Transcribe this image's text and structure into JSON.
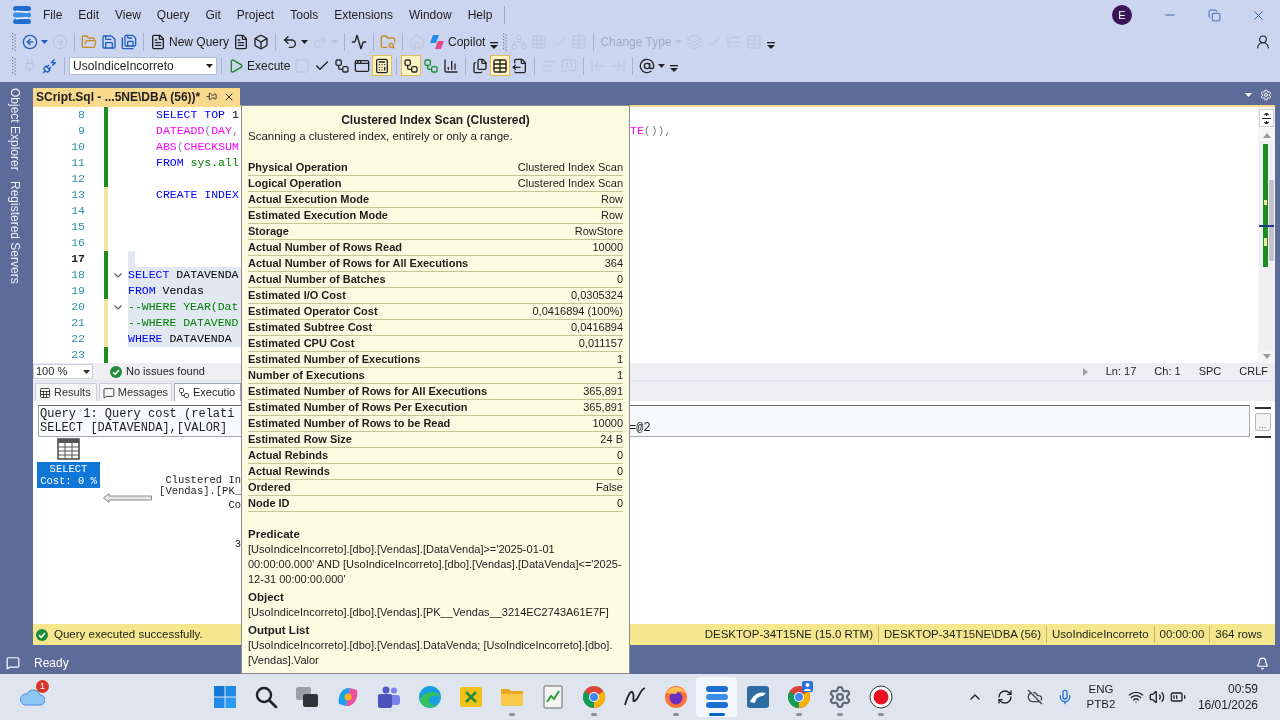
{
  "title_bar": {
    "menu": [
      "File",
      "Edit",
      "View",
      "Query",
      "Git",
      "Project",
      "Tools",
      "Extensions",
      "Window",
      "Help"
    ],
    "avatar": "E"
  },
  "toolbar_standard": {
    "items": [
      {
        "disabled": false
      },
      {
        "disabled": true
      },
      {
        "disabled": false
      },
      {
        "disabled": false
      },
      {
        "disabled": false
      },
      {
        "label": "New Query",
        "disabled": false
      },
      {
        "disabled": false
      },
      {
        "disabled": false
      },
      {
        "disabled": false
      },
      {
        "disabled": true
      },
      {
        "disabled": false
      },
      {
        "disabled": false
      },
      {
        "disabled": true
      },
      {
        "label": "Copilot",
        "disabled": false
      },
      {
        "disabled": true
      },
      {
        "disabled": true
      },
      {
        "disabled": true
      },
      {
        "disabled": true
      },
      {
        "label": "Change Type",
        "disabled": true
      },
      {
        "disabled": true
      },
      {
        "disabled": true
      },
      {
        "disabled": true
      },
      {
        "disabled": true
      }
    ]
  },
  "toolbar_sql": {
    "items": [
      {
        "disabled": true,
        "on": false
      },
      {
        "disabled": false,
        "on": false
      },
      {
        "label": "Execute",
        "disabled": false,
        "on": false
      },
      {
        "disabled": true,
        "on": false
      },
      {
        "disabled": false,
        "on": false
      },
      {
        "disabled": false,
        "on": false
      },
      {
        "disabled": false,
        "on": false
      },
      {
        "disabled": false,
        "on": true
      },
      {
        "disabled": false,
        "on": true
      },
      {
        "disabled": false,
        "on": false
      },
      {
        "disabled": false,
        "on": false
      },
      {
        "disabled": false,
        "on": false
      },
      {
        "disabled": false,
        "on": true
      },
      {
        "disabled": false,
        "on": false
      },
      {
        "disabled": true,
        "on": false
      },
      {
        "disabled": true,
        "on": false
      },
      {
        "disabled": true,
        "on": false
      },
      {
        "disabled": true,
        "on": false
      },
      {
        "disabled": false,
        "on": false
      }
    ],
    "database": "UsoIndiceIncorreto"
  },
  "side_panel": {
    "tabs": [
      "Object Explorer",
      "Registered Servers"
    ]
  },
  "document_tab": {
    "title": "SCript.Sql - ...5NE\\DBA (56))*",
    "selected": true
  },
  "editor": {
    "lines": [
      {
        "number": "8",
        "current": false,
        "selected": false,
        "fold": false,
        "indented": true,
        "color": "#1e8c1e",
        "tokens": [
          {
            "kind": "keyword",
            "text": "SELECT TOP"
          },
          {
            "kind": "plain",
            "text": " 1"
          }
        ]
      },
      {
        "number": "9",
        "current": false,
        "selected": false,
        "fold": false,
        "indented": true,
        "color": "#1e8c1e",
        "tokens": [
          {
            "kind": "function",
            "text": "DATEADD"
          },
          {
            "kind": "punct",
            "text": "("
          },
          {
            "kind": "function",
            "text": "DAY"
          },
          {
            "kind": "punct",
            "text": ","
          }
        ],
        "right_tokens": [
          {
            "kind": "function",
            "text": "TE"
          },
          {
            "kind": "punct",
            "text": "()),"
          }
        ]
      },
      {
        "number": "10",
        "current": false,
        "selected": false,
        "fold": false,
        "indented": true,
        "color": "#1e8c1e",
        "tokens": [
          {
            "kind": "function",
            "text": "ABS"
          },
          {
            "kind": "punct",
            "text": "("
          },
          {
            "kind": "function",
            "text": "CHECKSUM"
          }
        ]
      },
      {
        "number": "11",
        "current": false,
        "selected": false,
        "fold": false,
        "indented": true,
        "color": "#1e8c1e",
        "tokens": [
          {
            "kind": "keyword",
            "text": "FROM"
          },
          {
            "kind": "system",
            "text": " sys.all"
          }
        ]
      },
      {
        "number": "12",
        "current": false,
        "selected": false,
        "fold": false,
        "color": "#1e8c1e"
      },
      {
        "number": "13",
        "current": false,
        "selected": false,
        "fold": false,
        "indented": true,
        "color": "#f0e6a0",
        "tokens": [
          {
            "kind": "keyword",
            "text": "CREATE INDEX"
          }
        ]
      },
      {
        "number": "14",
        "current": false,
        "selected": false,
        "fold": false,
        "color": "#f0e6a0"
      },
      {
        "number": "15",
        "current": false,
        "selected": false,
        "fold": false,
        "color": "#f0e6a0"
      },
      {
        "number": "16",
        "current": false,
        "selected": false,
        "fold": false,
        "color": "#f0e6a0"
      },
      {
        "number": "17",
        "current": true,
        "selected": true,
        "fold": false,
        "color": "#1e8c1e"
      },
      {
        "number": "18",
        "current": false,
        "selected": true,
        "fold": true,
        "indented": false,
        "color": "#1e8c1e",
        "tokens": [
          {
            "kind": "keyword",
            "text": "SELECT"
          },
          {
            "kind": "plain",
            "text": " DATAVENDA"
          }
        ]
      },
      {
        "number": "19",
        "current": false,
        "selected": true,
        "fold": false,
        "indented": false,
        "color": "#1e8c1e",
        "tokens": [
          {
            "kind": "keyword",
            "text": "FROM"
          },
          {
            "kind": "plain",
            "text": " Vendas"
          }
        ]
      },
      {
        "number": "20",
        "current": false,
        "selected": true,
        "fold": true,
        "indented": false,
        "color": "#f0e6a0",
        "tokens": [
          {
            "kind": "comment",
            "text": "--WHERE YEAR(Dat"
          }
        ]
      },
      {
        "number": "21",
        "current": false,
        "selected": true,
        "fold": false,
        "indented": false,
        "color": "#f0e6a0",
        "tokens": [
          {
            "kind": "comment",
            "text": "--WHERE DATAVEND"
          }
        ]
      },
      {
        "number": "22",
        "current": false,
        "selected": true,
        "fold": false,
        "indented": false,
        "color": "#f0e6a0",
        "tokens": [
          {
            "kind": "keyword",
            "text": "WHERE"
          },
          {
            "kind": "plain",
            "text": " DATAVENDA"
          }
        ]
      },
      {
        "number": "23",
        "current": false,
        "selected": false,
        "fold": false,
        "color": "#1e8c1e"
      }
    ],
    "status": {
      "zoom": "100 %",
      "issues": "No issues found",
      "line": "Ln: 17",
      "column": "Ch: 1",
      "indent": "SPC",
      "line_endings": "CRLF"
    }
  },
  "results": {
    "tabs": [
      {
        "label": "Results",
        "selected": false
      },
      {
        "label": "Messages",
        "selected": false
      },
      {
        "label": "Executio",
        "selected": true
      }
    ],
    "plan": {
      "header": [
        "Query 1: Query cost (relati",
        "SELECT [DATAVENDA],[VALOR]"
      ],
      "header_right": "=@2",
      "more_button": "...",
      "select_node": {
        "title": "SELECT",
        "cost": "Cost: 0 %",
        "selected": true
      },
      "scan_node_text": [
        "Clustered In",
        "[Vendas].[PK_",
        "Co",
        "3"
      ]
    }
  },
  "query_status": {
    "message": "Query executed successfully.",
    "segments": [
      "DESKTOP-34T15NE (15.0 RTM)",
      "DESKTOP-34T15NE\\DBA (56)",
      "UsoIndiceIncorreto",
      "00:00:00",
      "364 rows"
    ]
  },
  "tooltip": {
    "title": "Clustered Index Scan (Clustered)",
    "description": "Scanning a clustered index, entirely or only a range.",
    "properties": [
      {
        "name": "Physical Operation",
        "value": "Clustered Index Scan"
      },
      {
        "name": "Logical Operation",
        "value": "Clustered Index Scan"
      },
      {
        "name": "Actual Execution Mode",
        "value": "Row"
      },
      {
        "name": "Estimated Execution Mode",
        "value": "Row"
      },
      {
        "name": "Storage",
        "value": "RowStore"
      },
      {
        "name": "Actual Number of Rows Read",
        "value": "10000"
      },
      {
        "name": "Actual Number of Rows for All Executions",
        "value": "364"
      },
      {
        "name": "Actual Number of Batches",
        "value": "0"
      },
      {
        "name": "Estimated I/O Cost",
        "value": "0,0305324"
      },
      {
        "name": "Estimated Operator Cost",
        "value": "0,0416894 (100%)"
      },
      {
        "name": "Estimated Subtree Cost",
        "value": "0,0416894"
      },
      {
        "name": "Estimated CPU Cost",
        "value": "0,011157"
      },
      {
        "name": "Estimated Number of Executions",
        "value": "1"
      },
      {
        "name": "Number of Executions",
        "value": "1"
      },
      {
        "name": "Estimated Number of Rows for All Executions",
        "value": "365,891"
      },
      {
        "name": "Estimated Number of Rows Per Execution",
        "value": "365,891"
      },
      {
        "name": "Estimated Number of Rows to be Read",
        "value": "10000"
      },
      {
        "name": "Estimated Row Size",
        "value": "24 B"
      },
      {
        "name": "Actual Rebinds",
        "value": "0"
      },
      {
        "name": "Actual Rewinds",
        "value": "0"
      },
      {
        "name": "Ordered",
        "value": "False"
      },
      {
        "name": "Node ID",
        "value": "0"
      }
    ],
    "sections": [
      {
        "heading": "Predicate",
        "text": "[UsoIndiceIncorreto].[dbo].[Vendas].[DataVenda]>='2025-01-01 00:00:00.000' AND [UsoIndiceIncorreto].[dbo].[Vendas].[DataVenda]<='2025-12-31 00:00:00.000'"
      },
      {
        "heading": "Object",
        "text": "[UsoIndiceIncorreto].[dbo].[Vendas].[PK__Vendas__3214EC2743A61E7F]"
      },
      {
        "heading": "Output List",
        "text": "[UsoIndiceIncorreto].[dbo].[Vendas].DataVenda; [UsoIndiceIncorreto].[dbo].[Vendas].Valor"
      }
    ]
  },
  "status_bar": {
    "text": "Ready"
  },
  "taskbar": {
    "weather_badge": "1",
    "apps": [
      {
        "running": false,
        "selected": false
      },
      {
        "running": false,
        "selected": false
      },
      {
        "running": false,
        "selected": false
      },
      {
        "running": false,
        "selected": false
      },
      {
        "running": false,
        "selected": false
      },
      {
        "running": false,
        "selected": false
      },
      {
        "running": false,
        "selected": false
      },
      {
        "running": true,
        "selected": false
      },
      {
        "running": false,
        "selected": false
      },
      {
        "running": true,
        "selected": false
      },
      {
        "running": false,
        "selected": false
      },
      {
        "running": true,
        "selected": false
      },
      {
        "running": true,
        "selected": true
      },
      {
        "running": false,
        "selected": false
      },
      {
        "running": true,
        "selected": false
      },
      {
        "running": true,
        "selected": false
      },
      {
        "running": true,
        "selected": false
      }
    ],
    "tray": {
      "language": "ENG",
      "layout": "PTB2",
      "time": "00:59",
      "date": "16/01/2026"
    }
  }
}
